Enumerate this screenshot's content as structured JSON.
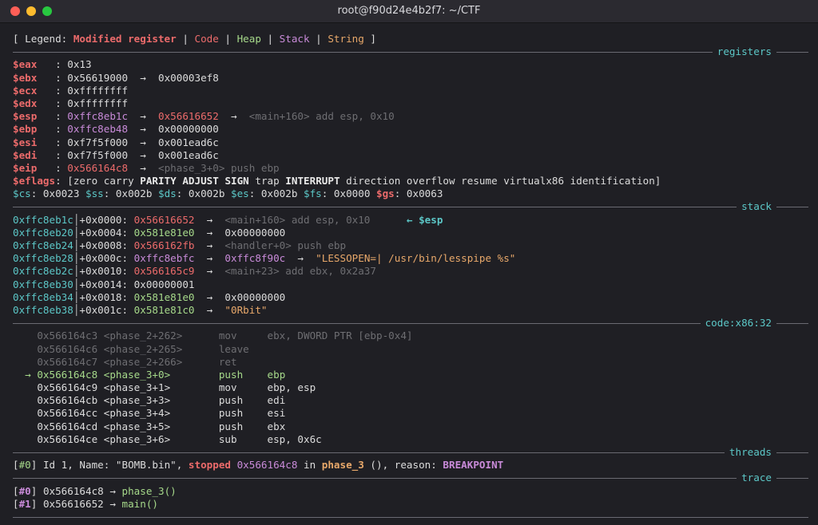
{
  "window": {
    "title": "root@f90d24e4b2f7: ~/CTF"
  },
  "legend": {
    "open": "[ Legend: ",
    "modified": "Modified register",
    "sep": " | ",
    "code": "Code",
    "heap": "Heap",
    "stack": "Stack",
    "string": "String",
    "close": " ]"
  },
  "sections": {
    "registers": "registers",
    "stack": "stack",
    "code": "code:x86:32",
    "threads": "threads",
    "trace": "trace"
  },
  "registers": [
    {
      "name": "$eax   ",
      "value": "0x13"
    },
    {
      "name": "$ebx   ",
      "value": "0x56619000",
      "arrow": "  →  ",
      "target": "0x00003ef8"
    },
    {
      "name": "$ecx   ",
      "value": "0xffffffff"
    },
    {
      "name": "$edx   ",
      "value": "0xffffffff"
    },
    {
      "name": "$esp   ",
      "value": "0xffc8eb1c",
      "arrow": "  →  ",
      "target": "0x56616652",
      "arrow2": "  →  ",
      "desc": "<main+160> add esp, 0x10"
    },
    {
      "name": "$ebp   ",
      "value": "0xffc8eb48",
      "arrow": "  →  ",
      "target": "0x00000000"
    },
    {
      "name": "$esi   ",
      "value": "0xf7f5f000",
      "arrow": "  →  ",
      "target": "0x001ead6c"
    },
    {
      "name": "$edi   ",
      "value": "0xf7f5f000",
      "arrow": "  →  ",
      "target": "0x001ead6c"
    },
    {
      "name": "$eip   ",
      "value": "0x566164c8",
      "arrow": "  →  ",
      "desc": "<phase_3+0> push ebp"
    }
  ],
  "colon": ": ",
  "eflags": {
    "name": "$eflags",
    "open": ": [",
    "zero": "zero ",
    "carry": "carry ",
    "parity": "PARITY",
    "adjust": "ADJUST",
    "sign": "SIGN",
    "trap": " trap ",
    "interrupt": "INTERRUPT",
    "rest": " direction overflow resume virtualx86 identification]"
  },
  "segments": {
    "cs": "$cs",
    "cs_val": ": 0x0023 ",
    "ss": "$ss",
    "ss_val": ": 0x002b ",
    "ds": "$ds",
    "ds_val": ": 0x002b ",
    "es": "$es",
    "es_val": ": 0x002b ",
    "fs": "$fs",
    "fs_val": ": 0x0000 ",
    "gs": "$gs",
    "gs_val": ": 0x0063"
  },
  "stack": [
    {
      "addr": "0xffc8eb1c",
      "off": "+0x0000: ",
      "val": "0x56616652",
      "arrow": "  →  ",
      "ptr": "<main+160> add esp, 0x10",
      "note_arrow": "      ← ",
      "note": "$esp"
    },
    {
      "addr": "0xffc8eb20",
      "off": "+0x0004: ",
      "val": "0x581e81e0",
      "arrow": "  →  ",
      "ptr": "0x00000000"
    },
    {
      "addr": "0xffc8eb24",
      "off": "+0x0008: ",
      "val": "0x566162fb",
      "arrow": "  →  ",
      "ptr": "<handler+0> push ebp"
    },
    {
      "addr": "0xffc8eb28",
      "off": "+0x000c: ",
      "val": "0xffc8ebfc",
      "arrow": "  →  ",
      "ptr": "0xffc8f90c",
      "arrow2": "  →  ",
      "str": "\"LESSOPEN=| /usr/bin/lesspipe %s\""
    },
    {
      "addr": "0xffc8eb2c",
      "off": "+0x0010: ",
      "val": "0x566165c9",
      "arrow": "  →  ",
      "ptr": "<main+23> add ebx, 0x2a37"
    },
    {
      "addr": "0xffc8eb30",
      "off": "+0x0014: ",
      "val": "0x00000001"
    },
    {
      "addr": "0xffc8eb34",
      "off": "+0x0018: ",
      "val": "0x581e81e0",
      "arrow": "  →  ",
      "ptr": "0x00000000"
    },
    {
      "addr": "0xffc8eb38",
      "off": "+0x001c: ",
      "val": "0x581e81c0",
      "arrow": "  →  ",
      "str": "\"0Rbit\""
    }
  ],
  "code": [
    {
      "marker": "  ",
      "addr": "0x566164c3",
      "sym": "<phase_2+262>",
      "mnem": "mov",
      "ops": "ebx, DWORD PTR [ebp-0x4]",
      "state": "past"
    },
    {
      "marker": "  ",
      "addr": "0x566164c6",
      "sym": "<phase_2+265>",
      "mnem": "leave",
      "ops": "",
      "state": "past"
    },
    {
      "marker": "  ",
      "addr": "0x566164c7",
      "sym": "<phase_2+266>",
      "mnem": "ret",
      "ops": "",
      "state": "past"
    },
    {
      "marker": "→ ",
      "addr": "0x566164c8",
      "sym": "<phase_3+0>",
      "mnem": "push",
      "ops": "ebp",
      "state": "current"
    },
    {
      "marker": "  ",
      "addr": "0x566164c9",
      "sym": "<phase_3+1>",
      "mnem": "mov",
      "ops": "ebp, esp",
      "state": "next"
    },
    {
      "marker": "  ",
      "addr": "0x566164cb",
      "sym": "<phase_3+3>",
      "mnem": "push",
      "ops": "edi",
      "state": "next"
    },
    {
      "marker": "  ",
      "addr": "0x566164cc",
      "sym": "<phase_3+4>",
      "mnem": "push",
      "ops": "esi",
      "state": "next"
    },
    {
      "marker": "  ",
      "addr": "0x566164cd",
      "sym": "<phase_3+5>",
      "mnem": "push",
      "ops": "ebx",
      "state": "next"
    },
    {
      "marker": "  ",
      "addr": "0x566164ce",
      "sym": "<phase_3+6>",
      "mnem": "sub",
      "ops": "esp, 0x6c",
      "state": "next"
    }
  ],
  "thread": {
    "open": "[",
    "id": "#0",
    "close": "] ",
    "text": "Id 1, Name: \"BOMB.bin\", ",
    "stopped": "stopped",
    "addr": " 0x566164c8",
    "in": " in ",
    "func": "phase_3",
    "rest": " (), reason: ",
    "reason": "BREAKPOINT"
  },
  "trace": [
    {
      "open": "[",
      "id": "#0",
      "close": "] ",
      "addr": "0x566164c8",
      "arrow": " → ",
      "func": "phase_3()"
    },
    {
      "open": "[",
      "id": "#1",
      "close": "] ",
      "addr": "0x56616652",
      "arrow": " → ",
      "func": "main()"
    }
  ],
  "colors": {
    "background": "#1f1f24",
    "modified": "#ec6b6b",
    "code": "#a6d98a",
    "stack": "#c98bd9",
    "string": "#e8a86a",
    "section": "#5cc7c7"
  }
}
